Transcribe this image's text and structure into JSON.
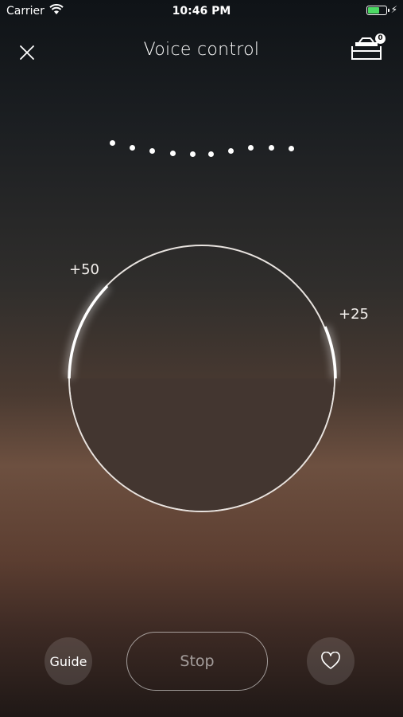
{
  "status_bar": {
    "carrier": "Carrier",
    "time": "10:46 PM",
    "battery_fraction": 0.65,
    "battery_color": "#4cd964"
  },
  "header": {
    "title": "Voice control",
    "device_badge": "0",
    "close_icon": "close-icon",
    "device_icon": "range-hood-icon"
  },
  "dial": {
    "fill_fraction": 0.5,
    "left_mark": "+50",
    "right_mark": "+25"
  },
  "voice_dots_count": 10,
  "controls": {
    "guide_label": "Guide",
    "stop_label": "Stop",
    "favorite_icon": "heart-icon"
  }
}
